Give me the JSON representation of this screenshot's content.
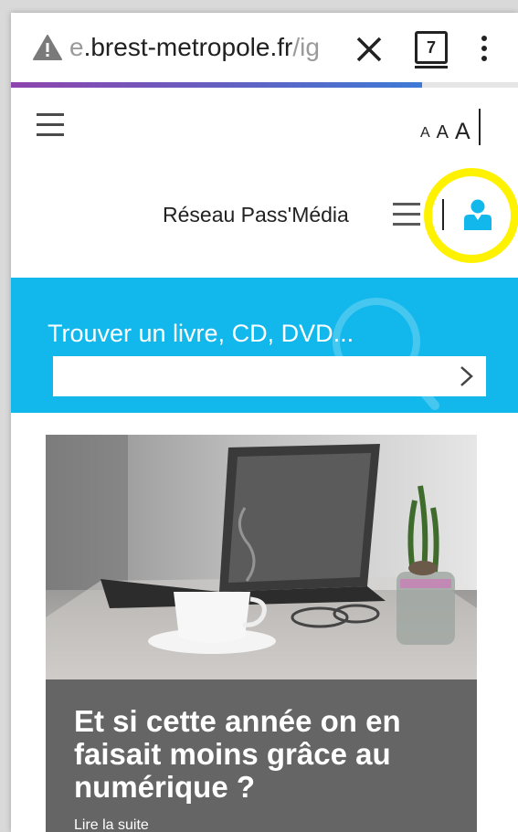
{
  "browser": {
    "url_prefix": "e",
    "url_domain": ".brest-metropole.fr",
    "url_path": "/ig",
    "tab_count": "7",
    "load_progress": 0.81,
    "icons": [
      "warning-icon",
      "close-icon",
      "tabs-icon",
      "menu-dots-icon"
    ]
  },
  "header": {
    "font_small": "A",
    "font_medium": "A",
    "font_large": "A",
    "network_label": "Réseau Pass'Média",
    "icons": [
      "hamburger-icon",
      "user-icon"
    ],
    "highlight_color": "#fff200",
    "user_icon_color": "#12b8ec"
  },
  "search": {
    "title": "Trouver un livre, CD, DVD...",
    "value": "",
    "banner_color": "#12b8ec"
  },
  "news": {
    "title": "Et si cette année on en faisait moins grâce au numérique ?",
    "read_more": "Lire la suite",
    "caption_color": "#656565"
  }
}
